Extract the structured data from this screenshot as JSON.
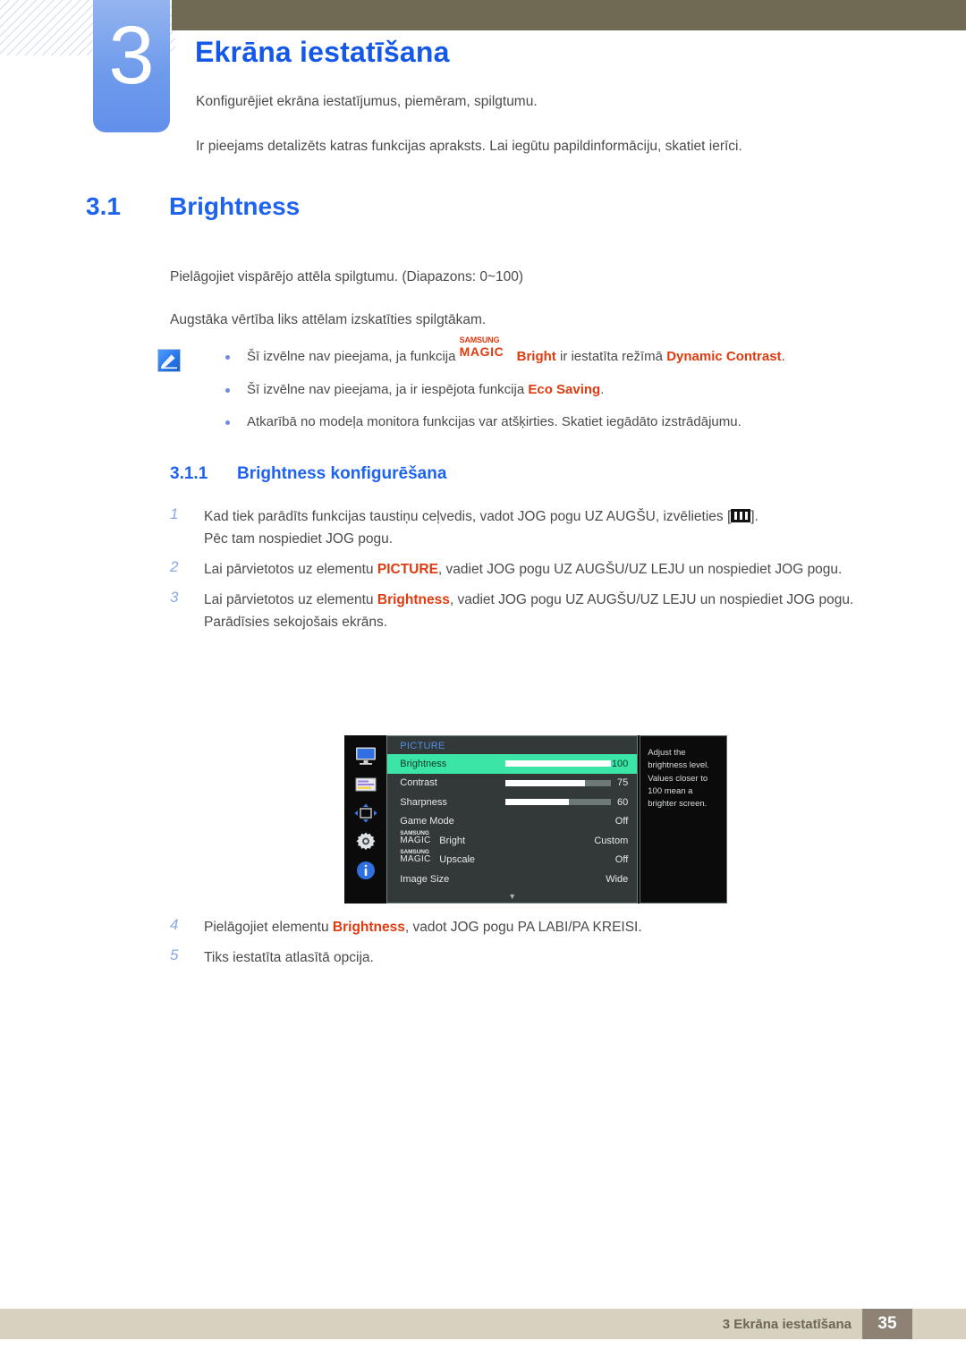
{
  "header": {
    "chapter_number": "3",
    "chapter_title": "Ekrāna iestatīšana",
    "intro_line_1": "Konfigurējiet ekrāna iestatījumus, piemēram, spilgtumu.",
    "intro_line_2": "Ir pieejams detalizēts katras funkcijas apraksts. Lai iegūtu papildinformāciju, skatiet ierīci."
  },
  "section": {
    "number": "3.1",
    "title": "Brightness",
    "paragraph_1": "Pielāgojiet vispārējo attēla spilgtumu. (Diapazons: 0~100)",
    "paragraph_2": "Augstāka vērtība liks attēlam izskatīties spilgtākam."
  },
  "note": {
    "icon": "note-pencil-icon",
    "item_1_a": "Šī izvēlne nav pieejama, ja funkcija ",
    "item_1_brand_top": "SAMSUNG",
    "item_1_brand_bottom": "MAGIC",
    "item_1_brand_suffix": "Bright",
    "item_1_b": " ir iestatīta režīmā ",
    "item_1_highlight": "Dynamic Contrast",
    "item_1_c": ".",
    "item_2_a": "Šī izvēlne nav pieejama, ja ir iespējota funkcija ",
    "item_2_highlight": "Eco Saving",
    "item_2_b": ".",
    "item_3": "Atkarībā no modeļa monitora funkcijas var atšķirties. Skatiet iegādāto izstrādājumu."
  },
  "subsection": {
    "number": "3.1.1",
    "title": "Brightness konfigurēšana"
  },
  "steps": [
    {
      "num": "1",
      "text_before": "Kad tiek parādīts funkcijas taustiņu ceļvedis, vadot JOG pogu UZ AUGŠU, izvēlieties [",
      "icon": "menu-bars-icon",
      "text_after": "].",
      "sub": "Pēc tam nospiediet JOG pogu."
    },
    {
      "num": "2",
      "text_before": "Lai pārvietotos uz elementu ",
      "highlight": "PICTURE",
      "text_after": ", vadiet JOG pogu UZ AUGŠU/UZ LEJU un nospiediet JOG pogu."
    },
    {
      "num": "3",
      "text_before": "Lai pārvietotos uz elementu ",
      "highlight": "Brightness",
      "text_after": ", vadiet JOG pogu UZ AUGŠU/UZ LEJU un nospiediet JOG pogu.",
      "sub": "Parādīsies sekojošais ekrāns."
    }
  ],
  "steps_after": [
    {
      "num": "4",
      "text_before": "Pielāgojiet elementu ",
      "highlight": "Brightness",
      "text_after": ", vadot JOG pogu PA LABI/PA KREISI."
    },
    {
      "num": "5",
      "text_before": "Tiks iestatīta atlasītā opcija.",
      "highlight": "",
      "text_after": ""
    }
  ],
  "osd": {
    "title": "PICTURE",
    "rail_icons": [
      "monitor-icon",
      "osd-list-icon",
      "position-arrows-icon",
      "gear-icon",
      "info-icon"
    ],
    "rows": [
      {
        "label": "Brightness",
        "value": "100",
        "bar": 100,
        "selected": true,
        "magic": false
      },
      {
        "label": "Contrast",
        "value": "75",
        "bar": 75,
        "selected": false,
        "magic": false
      },
      {
        "label": "Sharpness",
        "value": "60",
        "bar": 60,
        "selected": false,
        "magic": false
      },
      {
        "label": "Game Mode",
        "value": "Off",
        "bar": null,
        "selected": false,
        "magic": false
      },
      {
        "label": "Bright",
        "value": "Custom",
        "bar": null,
        "selected": false,
        "magic": true,
        "magic_top": "SAMSUNG",
        "magic_bottom": "MAGIC"
      },
      {
        "label": "Upscale",
        "value": "Off",
        "bar": null,
        "selected": false,
        "magic": true,
        "magic_top": "SAMSUNG",
        "magic_bottom": "MAGIC"
      },
      {
        "label": "Image Size",
        "value": "Wide",
        "bar": null,
        "selected": false,
        "magic": false
      }
    ],
    "scroll_caret": "▼",
    "help_text": "Adjust the brightness level. Values closer to 100 mean a brighter screen.",
    "selected_color": "#3ae5a6",
    "title_color": "#4f8fe8"
  },
  "footer": {
    "text": "3 Ekrāna iestatīšana",
    "page": "35"
  },
  "colors": {
    "heading_blue": "#1e63f0",
    "chapter_tab_blue": "#6f9bec",
    "olive": "#6f6a53",
    "highlight_red": "#e03b10",
    "footer_bar": "#d7d2c0",
    "footer_page_bg": "#8d8273"
  }
}
